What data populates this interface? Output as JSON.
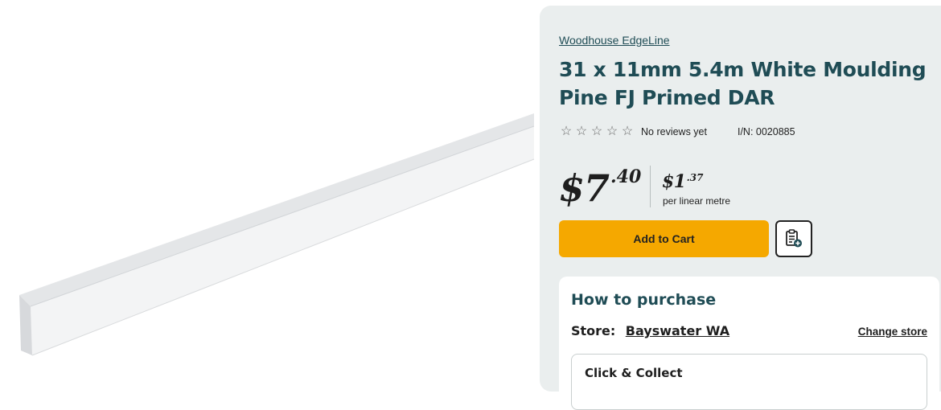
{
  "product_image": {
    "alt": "White primed pine moulding"
  },
  "product": {
    "brand": "Woodhouse EdgeLine",
    "title": "31 x 11mm 5.4m White Moulding Pine FJ Primed DAR",
    "rating": {
      "stars_filled": 0,
      "stars_total": 5,
      "reviews_text": "No reviews yet"
    },
    "item_number": "I/N: 0020885"
  },
  "price": {
    "dollars": "$7",
    "cents": ".40",
    "unit_dollars": "$1",
    "unit_cents": ".37",
    "unit_label": "per linear metre"
  },
  "actions": {
    "add_to_cart_label": "Add to Cart",
    "add_to_list_icon": "clipboard-add-icon"
  },
  "purchase": {
    "heading": "How to purchase",
    "store_label": "Store:",
    "store_name": "Bayswater WA",
    "change_store_label": "Change store",
    "option_title": "Click & Collect"
  },
  "colors": {
    "brand_teal": "#1f4c55",
    "cart_yellow": "#f5a800",
    "panel_bg": "#eaeeee"
  }
}
